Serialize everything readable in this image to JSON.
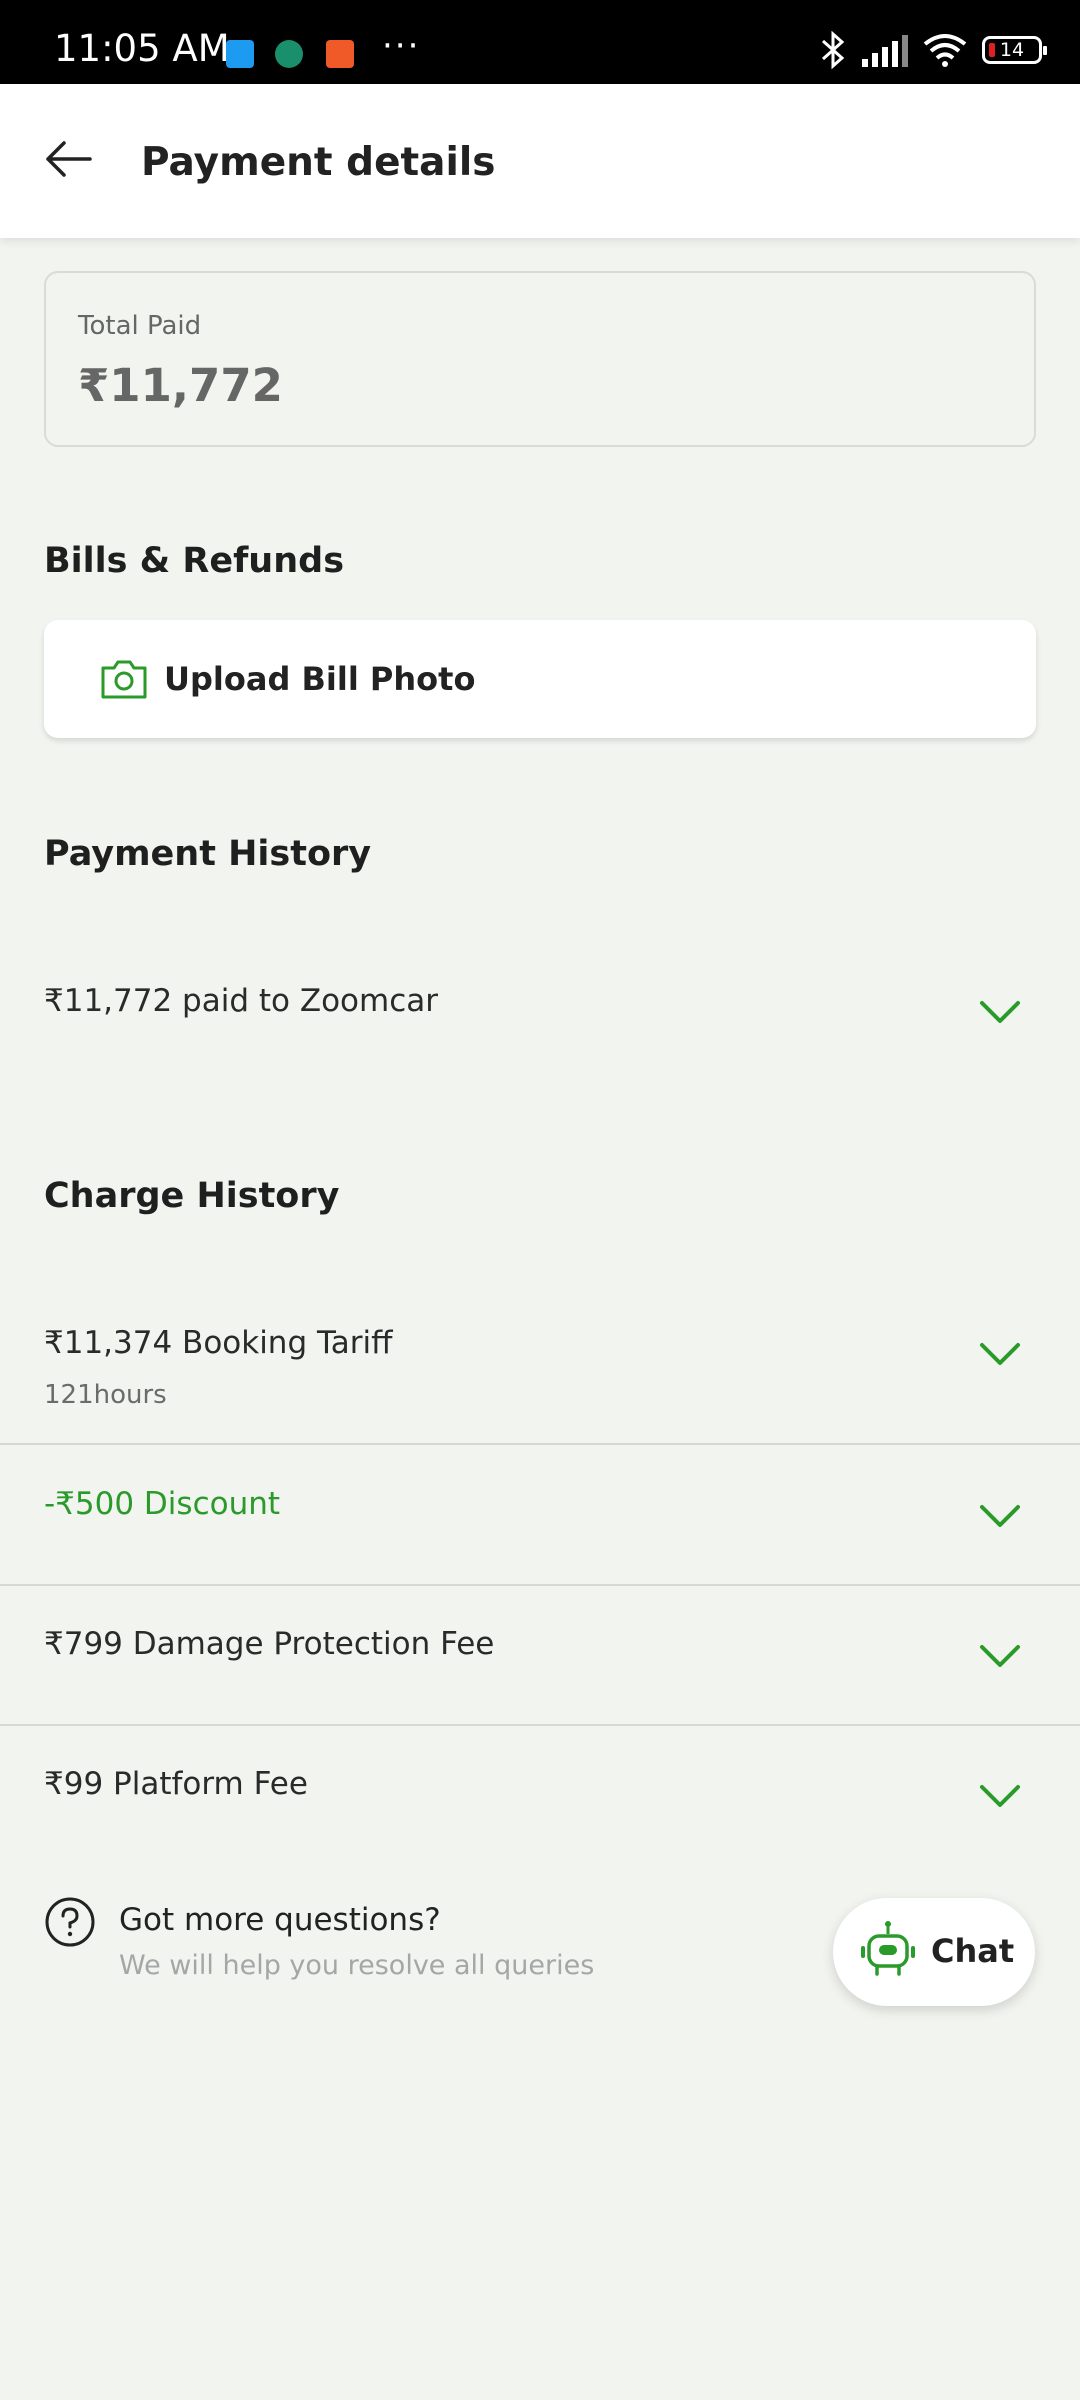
{
  "status_bar": {
    "time": "11:05 AM",
    "dots": "···",
    "battery": "14"
  },
  "header": {
    "title": "Payment details"
  },
  "total": {
    "label": "Total Paid",
    "value": "₹11,772"
  },
  "bills": {
    "title": "Bills & Refunds",
    "upload_label": "Upload Bill Photo"
  },
  "payment_history": {
    "title": "Payment History",
    "items": [
      {
        "label": "₹11,772 paid to Zoomcar"
      }
    ]
  },
  "charge_history": {
    "title": "Charge History",
    "items": [
      {
        "label": "₹11,374 Booking Tariff",
        "sub": "121hours"
      },
      {
        "label": "-₹500 Discount"
      },
      {
        "label": "₹799 Damage Protection Fee"
      },
      {
        "label": "₹99 Platform Fee"
      }
    ]
  },
  "help": {
    "title": "Got more questions?",
    "subtitle": "We will help you resolve all queries"
  },
  "chat": {
    "label": "Chat"
  },
  "colors": {
    "accent": "#2a9a2a",
    "background": "#f2f4ef"
  }
}
